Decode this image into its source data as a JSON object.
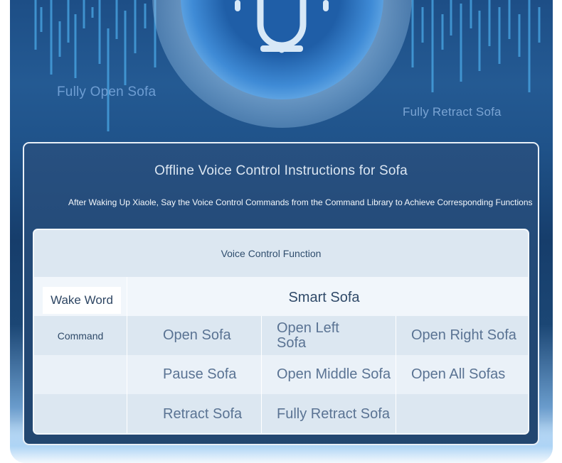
{
  "banner": {
    "left_label": "Fully Open Sofa",
    "right_label": "Fully Retract Sofa",
    "icon": "microphone-icon"
  },
  "card": {
    "title": "Offline Voice Control Instructions for Sofa",
    "subtitle": "After Waking Up Xiaole, Say the Voice Control Commands from the Command Library to Achieve Corresponding Functions"
  },
  "table": {
    "header": "Voice Control Function",
    "wake_word_label": "Wake Word",
    "wake_word_value": "Smart Sofa",
    "command_label": "Command",
    "commands": [
      [
        "Open Sofa",
        "Open Left Sofa",
        "Open Right Sofa"
      ],
      [
        "Pause Sofa",
        "Open Middle Sofa",
        "Open All Sofas"
      ],
      [
        "Retract Sofa",
        "Fully Retract Sofa",
        ""
      ]
    ]
  },
  "colors": {
    "card_bg": "#28507f",
    "table_bg": "#e7eff7",
    "accent_blue": "#3f8bd6"
  }
}
